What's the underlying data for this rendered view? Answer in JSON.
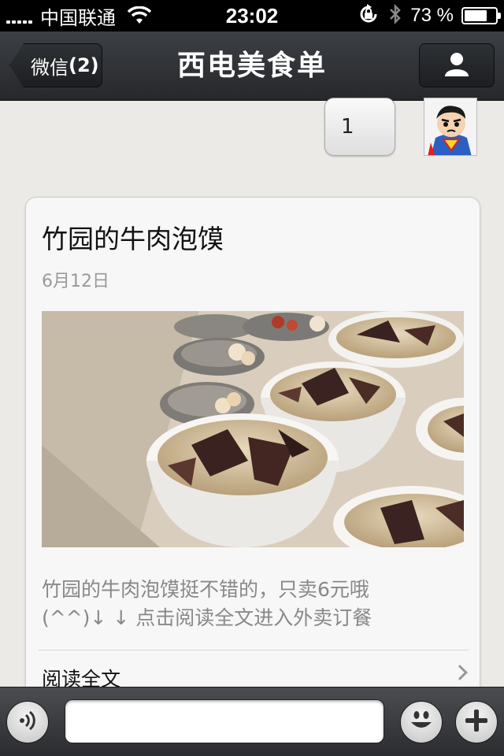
{
  "status_bar": {
    "carrier": "中国联通",
    "time": "23:02",
    "battery_percent": "73 %",
    "battery_level": 0.73,
    "icons": [
      "signal-bars-icon",
      "wifi-icon",
      "rotation-lock-icon",
      "bluetooth-icon",
      "battery-icon"
    ]
  },
  "nav": {
    "back_label": "微信",
    "back_badge": "(2)",
    "title": "西电美食单",
    "right_icon": "person-icon"
  },
  "messages": [
    {
      "text": "1",
      "side": "right",
      "avatar": "superman-avatar"
    }
  ],
  "article": {
    "title": "竹园的牛肉泡馍",
    "date": "6月12日",
    "image": "beef-paomo-bowls-photo",
    "summary_line1": "竹园的牛肉泡馍挺不错的，只卖6元哦",
    "summary_line2": "(^^)↓ ↓ 点击阅读全文进入外卖订餐",
    "read_more": "阅读全文",
    "read_more_icon": "chevron-right-icon"
  },
  "input_bar": {
    "voice_icon": "voice-icon",
    "emoji_icon": "smiley-icon",
    "plus_icon": "plus-icon",
    "text_value": ""
  },
  "colors": {
    "nav_bg": "#2f3236",
    "page_bg": "#eceae6",
    "card_bg": "#f7f7f7"
  }
}
